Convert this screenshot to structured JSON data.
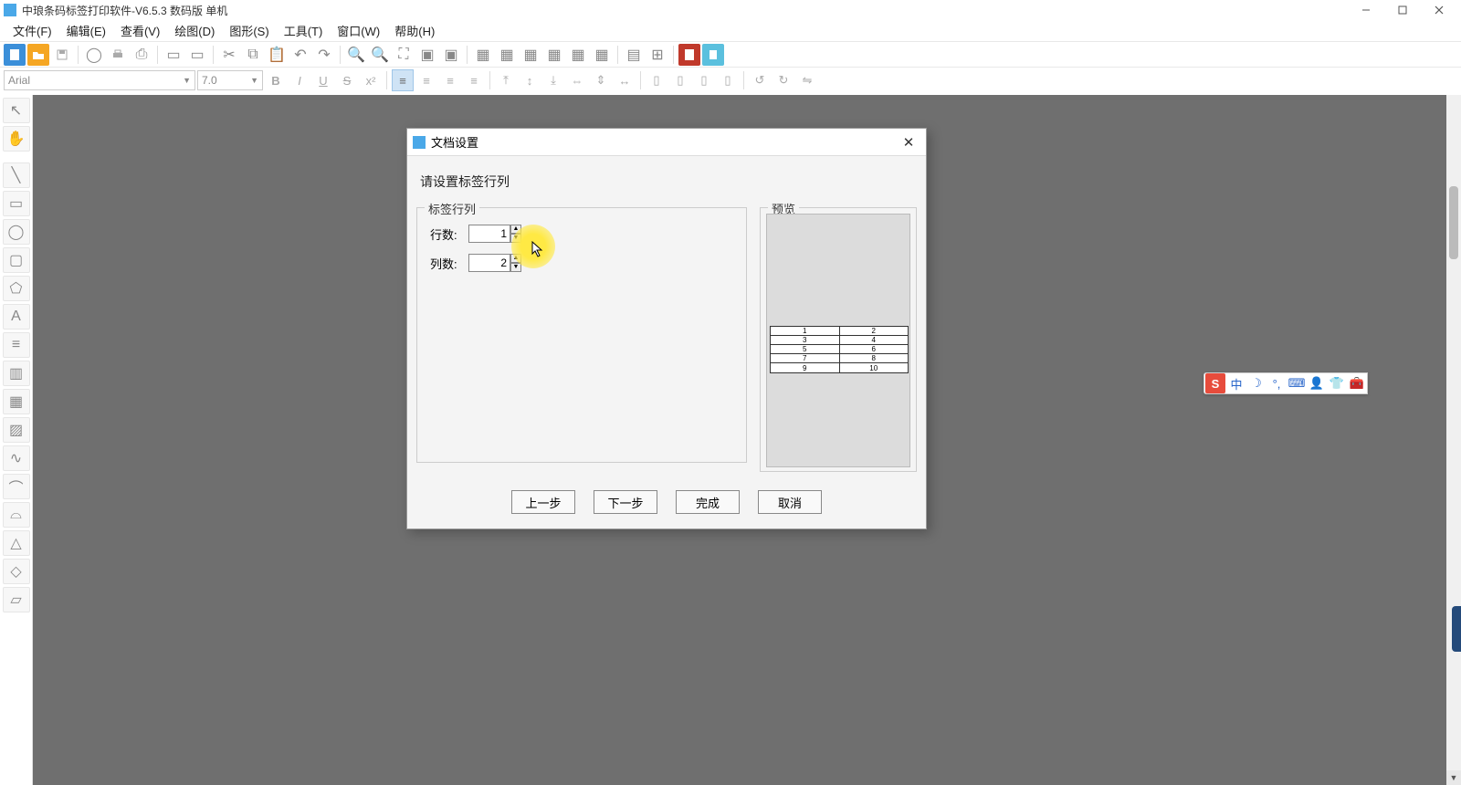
{
  "app": {
    "title": "中琅条码标签打印软件-V6.5.3 数码版 单机"
  },
  "menu": {
    "file": "文件(F)",
    "edit": "编辑(E)",
    "view": "查看(V)",
    "draw": "绘图(D)",
    "shape": "图形(S)",
    "tool": "工具(T)",
    "window": "窗口(W)",
    "help": "帮助(H)"
  },
  "font": {
    "name": "Arial",
    "size": "7.0"
  },
  "dialog": {
    "title": "文档设置",
    "prompt": "请设置标签行列",
    "group_label": "标签行列",
    "rows_label": "行数:",
    "cols_label": "列数:",
    "rows_value": "1",
    "cols_value": "2",
    "preview_label": "预览",
    "btn_prev": "上一步",
    "btn_next": "下一步",
    "btn_finish": "完成",
    "btn_cancel": "取消"
  },
  "preview_cells": [
    [
      "1",
      "2"
    ],
    [
      "3",
      "4"
    ],
    [
      "5",
      "6"
    ],
    [
      "7",
      "8"
    ],
    [
      "9",
      "10"
    ]
  ],
  "ime": {
    "logo": "S",
    "lang": "中"
  }
}
